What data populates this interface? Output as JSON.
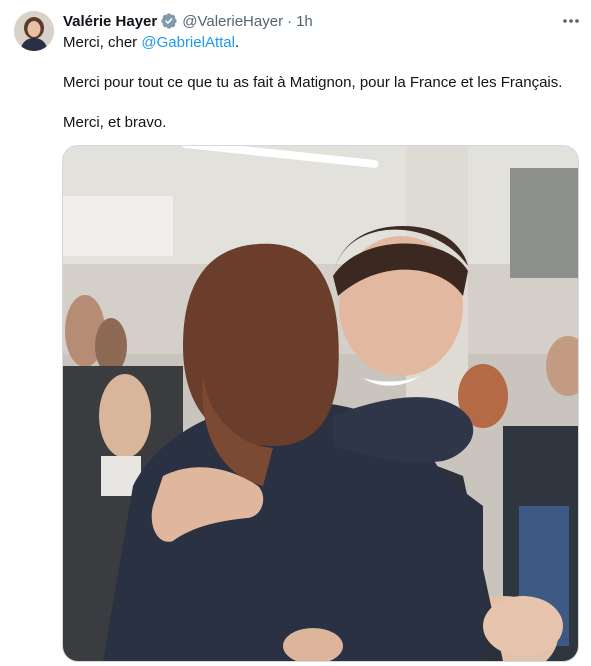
{
  "tweet": {
    "author_name": "Valérie Hayer",
    "author_handle": "@ValerieHayer",
    "separator": "·",
    "time": "1h",
    "line1_prefix": "Merci, cher ",
    "mention": "@GabrielAttal",
    "line1_suffix": ".",
    "line2": "Merci pour tout ce que tu as fait à Matignon, pour la France et les Français.",
    "line3": "Merci, et bravo."
  },
  "icons": {
    "verified": "verified-badge-icon",
    "more": "more-options-icon"
  },
  "colors": {
    "link": "#1d9bf0",
    "secondary_text": "#536471",
    "primary_text": "#0f1419",
    "verified_badge": "#829aab"
  }
}
